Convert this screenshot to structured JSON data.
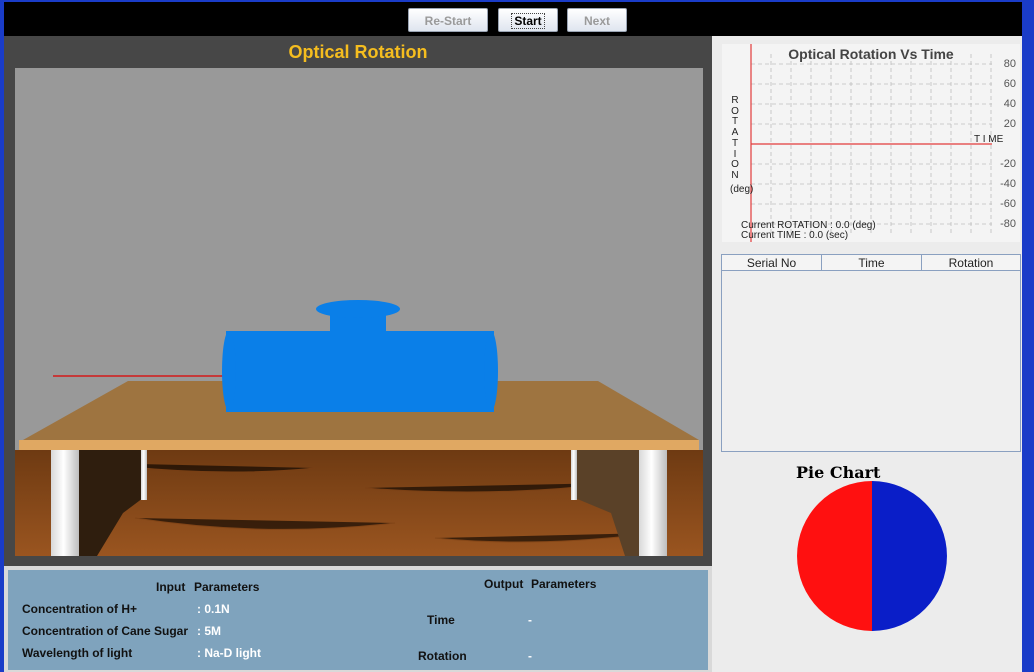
{
  "toolbar": {
    "restart_label": "Re-Start",
    "start_label": "Start",
    "next_label": "Next"
  },
  "simulation": {
    "title": "Optical Rotation"
  },
  "graph": {
    "title": "Optical Rotation Vs Time",
    "y_axis_vertical_label": [
      "R",
      "O",
      "T",
      "A",
      "T",
      "I",
      "O",
      "N"
    ],
    "y_unit": "(deg)",
    "x_axis_label": "T I ME",
    "y_ticks": [
      "80",
      "60",
      "40",
      "20",
      "",
      "-20",
      "-40",
      "-60",
      "-80"
    ],
    "current_rotation_label": "Current    ROTATION    : 0.0 (deg)",
    "current_time_label": "Current    TIME    : 0.0 (sec)"
  },
  "chart_data": {
    "type": "line",
    "title": "Optical Rotation Vs Time",
    "xlabel": "T I ME",
    "ylabel": "ROTATION (deg)",
    "ylim": [
      -90,
      90
    ],
    "y_ticks": [
      80,
      60,
      40,
      20,
      0,
      -20,
      -40,
      -60,
      -80
    ],
    "series": [],
    "grid": true
  },
  "results_table": {
    "columns": [
      "Serial No",
      "Time",
      "Rotation"
    ],
    "rows": []
  },
  "pie_chart": {
    "title": "Pie Chart",
    "slices": [
      {
        "value": 50,
        "color": "#ff1010"
      },
      {
        "value": 50,
        "color": "#0a1ec8"
      }
    ]
  },
  "input_parameters": {
    "header_left": "Input",
    "header_right": "Parameters",
    "rows": [
      {
        "label": "Concentration of H+",
        "value": ": 0.1N"
      },
      {
        "label": "Concentration of Cane Sugar",
        "value": ": 5M"
      },
      {
        "label": "Wavelength of light",
        "value": ": Na-D light"
      }
    ]
  },
  "output_parameters": {
    "header_left": "Output",
    "header_right": "Parameters",
    "rows": [
      {
        "label": "Time",
        "value": "-"
      },
      {
        "label": "Rotation",
        "value": "-"
      }
    ]
  },
  "colors": {
    "title_accent": "#f5bd1f",
    "polarimeter_tube": "#0a7fe8",
    "laser_line": "#e00000",
    "table_top": "#9e7440",
    "params_bg": "#7fa3bd"
  }
}
